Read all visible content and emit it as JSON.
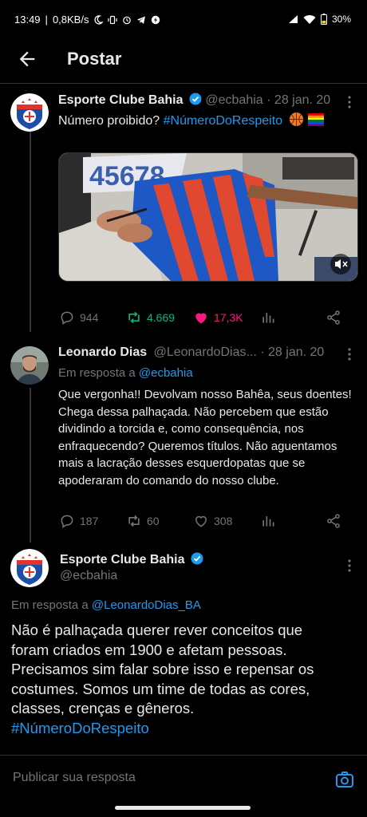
{
  "status_bar": {
    "time": "13:49",
    "speed": "0,8KB/s",
    "battery": "30%"
  },
  "header": {
    "title": "Postar"
  },
  "tweet1": {
    "name": "Esporte Clube Bahia",
    "handle": "@ecbahia",
    "date": "· 28 jan. 20",
    "text_prefix": "Número proibido? ",
    "hashtag": "#NúmeroDoRespeito",
    "jersey_number": "45678",
    "replies": "944",
    "retweets": "4.669",
    "likes": "17,3K"
  },
  "tweet2": {
    "name": "Leonardo Dias",
    "handle": "@LeonardoDias...",
    "date": "· 28 jan. 20",
    "reply_to_prefix": "Em resposta a ",
    "reply_to_handle": "@ecbahia",
    "text": "Que vergonha!! Devolvam nosso Bahêa, seus doentes! Chega dessa palhaçada. Não percebem que estão dividindo a torcida e, como consequência, nos enfraquecendo? Queremos títulos. Não aguentamos mais a lacração desses esquerdopatas que se apoderaram do comando do nosso clube.",
    "replies": "187",
    "retweets": "60",
    "likes": "308"
  },
  "tweet3": {
    "name": "Esporte Clube Bahia",
    "handle": "@ecbahia",
    "reply_to_prefix": "Em resposta a ",
    "reply_to_handle": "@LeonardoDias_BA",
    "text": "Não é palhaçada querer rever conceitos que foram criados em 1900 e afetam pessoas. Precisamos sim falar sobre isso e repensar os costumes. Somos um time de todas as cores, classes, crenças e gêneros.",
    "hashtag": "#NúmeroDoRespeito"
  },
  "reply_bar": {
    "placeholder": "Publicar sua resposta"
  },
  "colors": {
    "accent": "#1d9bf0",
    "retweet": "#00ba7c",
    "like": "#f91880",
    "bg": "#000000",
    "text": "#e7e9ea",
    "muted": "#71767b"
  }
}
